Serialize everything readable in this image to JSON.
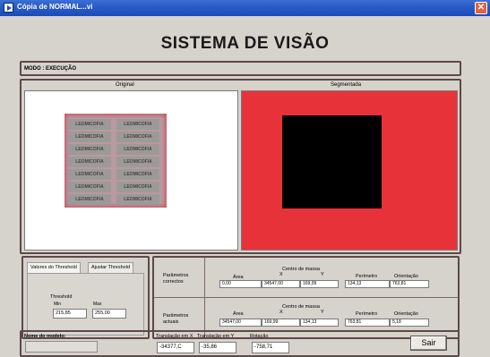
{
  "window": {
    "title": "Cópia de NORMAL...vi",
    "close_icon": "close-icon"
  },
  "main_title": "SISTEMA DE VISÃO",
  "modo": "MODO : EXECUÇÃO",
  "images": {
    "original_label": "Original",
    "segmented_label": "Segmentada",
    "label_text": "LEOMICOFIA",
    "colors": {
      "segmented_bg": "#e8323a",
      "object": "#000000"
    }
  },
  "threshold": {
    "tabs": [
      "Valores do Threshold",
      "Ajustar Threshold"
    ],
    "title": "Threshold",
    "min_label": "Min",
    "max_label": "Max",
    "min_value": "215,85",
    "max_value": "255,00"
  },
  "params": {
    "headers": {
      "area": "Área",
      "centro": "Centro de massa",
      "x": "X",
      "y": "Y",
      "perimetro": "Perímetro",
      "orientacao": "Orientação"
    },
    "correct_label": "Parâmetros correctos",
    "actual_label": "Parâmetros actuais",
    "correct_values": [
      "0,00",
      "34547,00",
      "169,99",
      "134,13",
      "763,81"
    ],
    "actual_values": [
      "34547,00",
      "169,99",
      "134,13",
      "763,81",
      "5,18"
    ]
  },
  "bottom": {
    "model_label": "Nome do modelo:",
    "trans_x_label": "Translação em X",
    "trans_y_label": "Translação em Y",
    "rot_label": "Rotação",
    "trans_x": "-34377,C",
    "trans_y": "-35,86",
    "rot": "-758,71",
    "exit": "Sair"
  }
}
